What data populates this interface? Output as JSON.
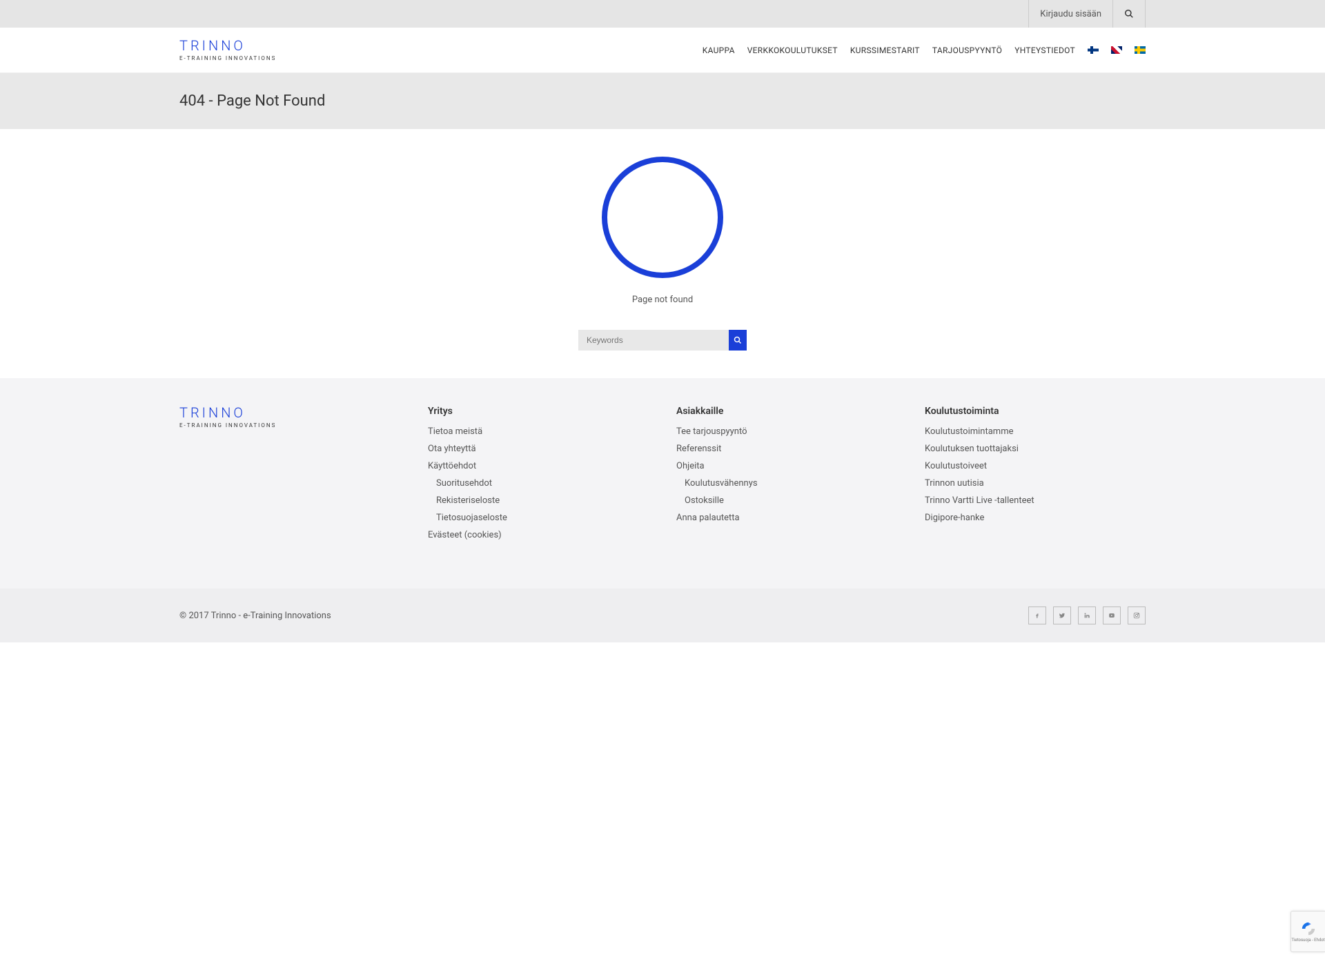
{
  "topbar": {
    "login": "Kirjaudu sisään"
  },
  "logo": {
    "name": "TRINNO",
    "tagline": "E-TRAINING INNOVATIONS"
  },
  "nav": {
    "items": [
      "KAUPPA",
      "VERKKOKOULUTUKSET",
      "KURSSIMESTARIT",
      "TARJOUSPYYNTÖ",
      "YHTEYSTIEDOT"
    ]
  },
  "page": {
    "title": "404 - Page Not Found",
    "message": "Page not found"
  },
  "search": {
    "placeholder": "Keywords"
  },
  "footer": {
    "col1": {
      "heading": "Yritys",
      "links": [
        "Tietoa meistä",
        "Ota yhteyttä",
        "Käyttöehdot"
      ],
      "sublinks": [
        "Suoritusehdot",
        "Rekisteriseloste",
        "Tietosuojaseloste"
      ],
      "link_after_sub": "Evästeet (cookies)"
    },
    "col2": {
      "heading": "Asiakkaille",
      "links": [
        "Tee tarjouspyyntö",
        "Referenssit",
        "Ohjeita"
      ],
      "sublinks": [
        "Koulutusvähennys",
        "Ostoksille"
      ],
      "link_after_sub": "Anna palautetta"
    },
    "col3": {
      "heading": "Koulutustoiminta",
      "links": [
        "Koulutustoimintamme",
        "Koulutuksen tuottajaksi",
        "Koulutustoiveet",
        "Trinnon uutisia",
        "Trinno Vartti Live -tallenteet",
        "Digipore-hanke"
      ]
    }
  },
  "copyright": "© 2017 Trinno - e-Training Innovations",
  "recaptcha": {
    "label": "Tietosuoja - Ehdot"
  }
}
